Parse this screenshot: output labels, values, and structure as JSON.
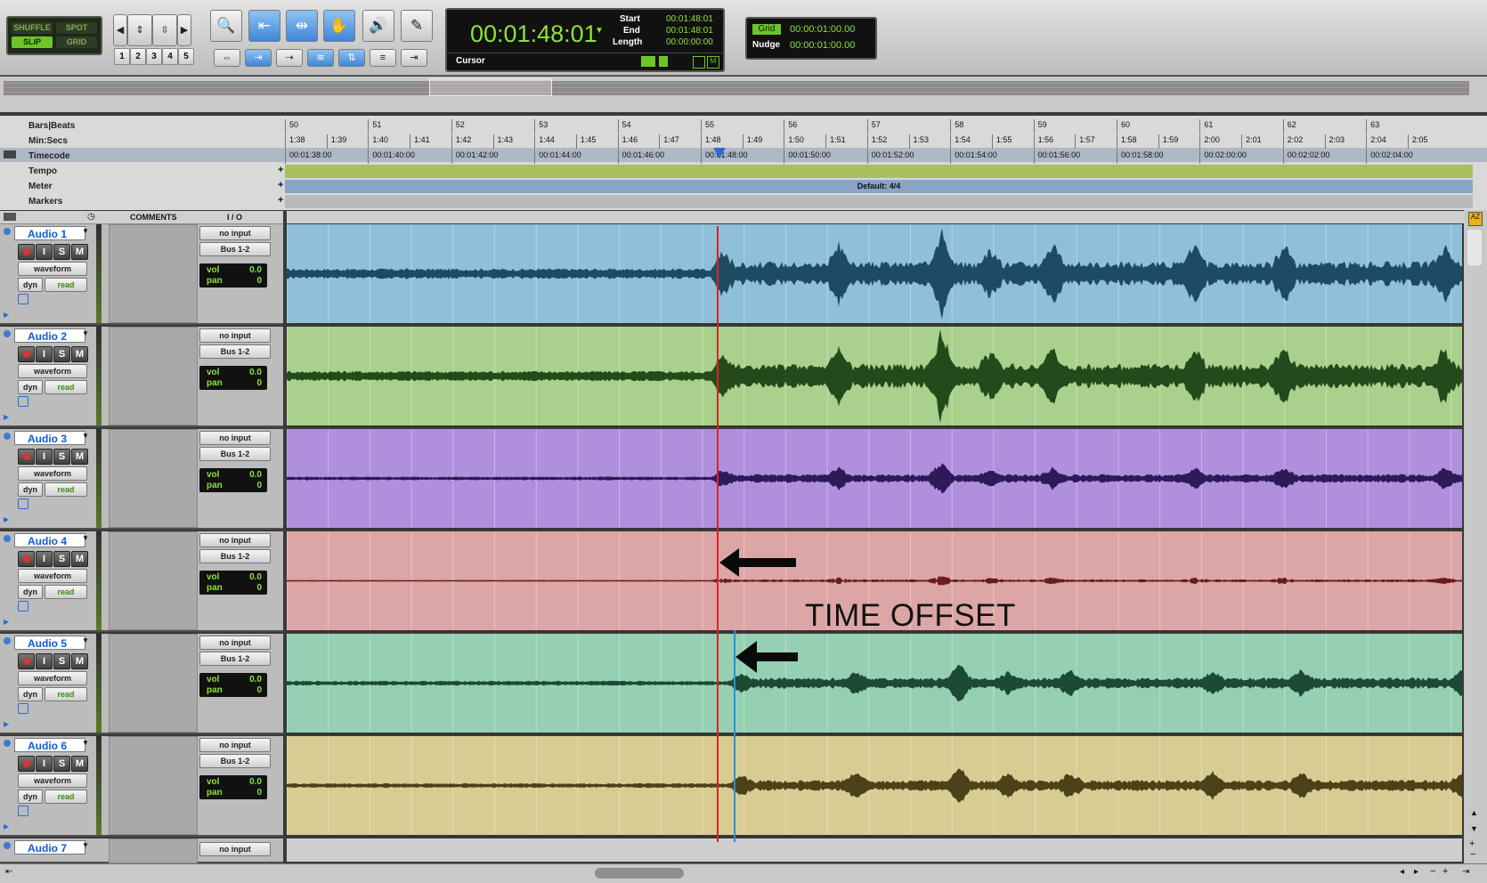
{
  "edit_modes": {
    "shuffle": "SHUFFLE",
    "spot": "SPOT",
    "slip": "SLIP",
    "grid": "GRID"
  },
  "zoom_presets": [
    "1",
    "2",
    "3",
    "4",
    "5"
  ],
  "counter": {
    "main": "00:01:48:01",
    "start_label": "Start",
    "start": "00:01:48:01",
    "end_label": "End",
    "end": "00:01:48:01",
    "length_label": "Length",
    "length": "00:00:00:00",
    "cursor_label": "Cursor"
  },
  "grid": {
    "label": "Grid",
    "value": "00:00:01:00.00",
    "nudge_label": "Nudge",
    "nudge_value": "00:00:01:00.00"
  },
  "rulers": {
    "bars_label": "Bars|Beats",
    "minsecs_label": "Min:Secs",
    "timecode_label": "Timecode",
    "tempo_label": "Tempo",
    "meter_label": "Meter",
    "markers_label": "Markers",
    "meter_value": "Default: 4/4",
    "bars": [
      "50",
      "51",
      "52",
      "53",
      "54",
      "55",
      "56",
      "57",
      "58",
      "59",
      "60",
      "61",
      "62",
      "63"
    ],
    "minsecs": [
      "1:38",
      "1:39",
      "1:40",
      "1:41",
      "1:42",
      "1:43",
      "1:44",
      "1:45",
      "1:46",
      "1:47",
      "1:48",
      "1:49",
      "1:50",
      "1:51",
      "1:52",
      "1:53",
      "1:54",
      "1:55",
      "1:56",
      "1:57",
      "1:58",
      "1:59",
      "2:00",
      "2:01",
      "2:02",
      "2:03",
      "2:04",
      "2:05"
    ],
    "timecode": [
      "00:01:38:00",
      "00:01:40:00",
      "00:01:42:00",
      "00:01:44:00",
      "00:01:46:00",
      "00:01:48:00",
      "00:01:50:00",
      "00:01:52:00",
      "00:01:54:00",
      "00:01:56:00",
      "00:01:58:00",
      "00:02:00:00",
      "00:02:02:00",
      "00:02:04:00"
    ]
  },
  "column_headers": {
    "comments": "COMMENTS",
    "io": "I / O"
  },
  "tracks": [
    {
      "name": "Audio 1",
      "view": "waveform",
      "dyn": "dyn",
      "auto": "read",
      "input": "no input",
      "output": "Bus 1-2",
      "vol": "0.0",
      "pan": "0",
      "color": "#8fbfd9",
      "wave": "#1f4a64"
    },
    {
      "name": "Audio 2",
      "view": "waveform",
      "dyn": "dyn",
      "auto": "read",
      "input": "no input",
      "output": "Bus 1-2",
      "vol": "0.0",
      "pan": "0",
      "color": "#a9d08c",
      "wave": "#244a1b"
    },
    {
      "name": "Audio 3",
      "view": "waveform",
      "dyn": "dyn",
      "auto": "read",
      "input": "no input",
      "output": "Bus 1-2",
      "vol": "0.0",
      "pan": "0",
      "color": "#b08fdc",
      "wave": "#2d1b59"
    },
    {
      "name": "Audio 4",
      "view": "waveform",
      "dyn": "dyn",
      "auto": "read",
      "input": "no input",
      "output": "Bus 1-2",
      "vol": "0.0",
      "pan": "0",
      "color": "#dda6a6",
      "wave": "#6a1c1c"
    },
    {
      "name": "Audio 5",
      "view": "waveform",
      "dyn": "dyn",
      "auto": "read",
      "input": "no input",
      "output": "Bus 1-2",
      "vol": "0.0",
      "pan": "0",
      "color": "#95d0b2",
      "wave": "#1c4a35"
    },
    {
      "name": "Audio 6",
      "view": "waveform",
      "dyn": "dyn",
      "auto": "read",
      "input": "no input",
      "output": "Bus 1-2",
      "vol": "0.0",
      "pan": "0",
      "color": "#d8cc92",
      "wave": "#4c421a"
    },
    {
      "name": "Audio 7",
      "input": "no input"
    }
  ],
  "labels": {
    "vol": "vol",
    "pan": "pan",
    "time_offset": "TIME OFFSET",
    "button_r": "R",
    "button_i": "I",
    "button_s": "S",
    "button_m": "M"
  },
  "icons": {
    "left": "chevron-left-icon",
    "right": "chevron-right-icon"
  }
}
